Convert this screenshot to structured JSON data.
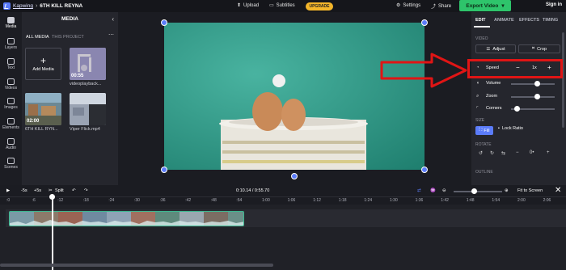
{
  "topbar": {
    "brand": "Kapwing",
    "separator": "›",
    "project": "6TH KILL REYNA",
    "upload": "Upload",
    "subtitles": "Subtitles",
    "upgrade": "UPGRADE",
    "settings": "Settings",
    "share": "Share",
    "export": "Export Video",
    "signin": "Sign in"
  },
  "rail": [
    "Media",
    "Layers",
    "Text",
    "Videos",
    "Images",
    "Elements",
    "Audio",
    "Scenes"
  ],
  "media": {
    "title": "MEDIA",
    "tab_all": "ALL MEDIA",
    "tab_project": "THIS PROJECT",
    "add": "Add Media",
    "items": [
      {
        "duration": "00:55",
        "name": "videoplayback..."
      },
      {
        "duration": "02:00",
        "name": "6TH KILL RYN..."
      },
      {
        "duration": "",
        "name": "Viper Flick.mp4"
      }
    ]
  },
  "props": {
    "tabs": [
      "EDIT",
      "ANIMATE",
      "EFFECTS",
      "TIMING"
    ],
    "video_label": "VIDEO",
    "adjust": "Adjust",
    "crop": "Crop",
    "speed": "Speed",
    "speed_value": "1x",
    "volume": "Volume",
    "zoom": "Zoom",
    "corners": "Corners",
    "size_label": "SIZE",
    "fill": "Fill",
    "lock_ratio": "Lock Ratio",
    "rotate_label": "ROTATE",
    "outline_label": "OUTLINE",
    "volume_level": 0.62,
    "zoom_level": 0.62,
    "corners_level": 0.08
  },
  "timeline": {
    "skip_back": "-5s",
    "skip_fwd": "+5s",
    "split": "Split",
    "time": "0:10.14 / 0:55.70",
    "fit": "Fit to Screen",
    "ticks": [
      ":0",
      ":6",
      ":12",
      ":18",
      ":24",
      ":30",
      ":36",
      ":42",
      ":48",
      ":54",
      "1:00",
      "1:06",
      "1:12",
      "1:18",
      "1:24",
      "1:30",
      "1:36",
      "1:42",
      "1:48",
      "1:54",
      "2:00",
      "2:06"
    ]
  },
  "colors": {
    "accent": "#5b7cfa",
    "export": "#2ec46b",
    "upgrade": "#f3b52a",
    "annotation": "#e01515"
  }
}
